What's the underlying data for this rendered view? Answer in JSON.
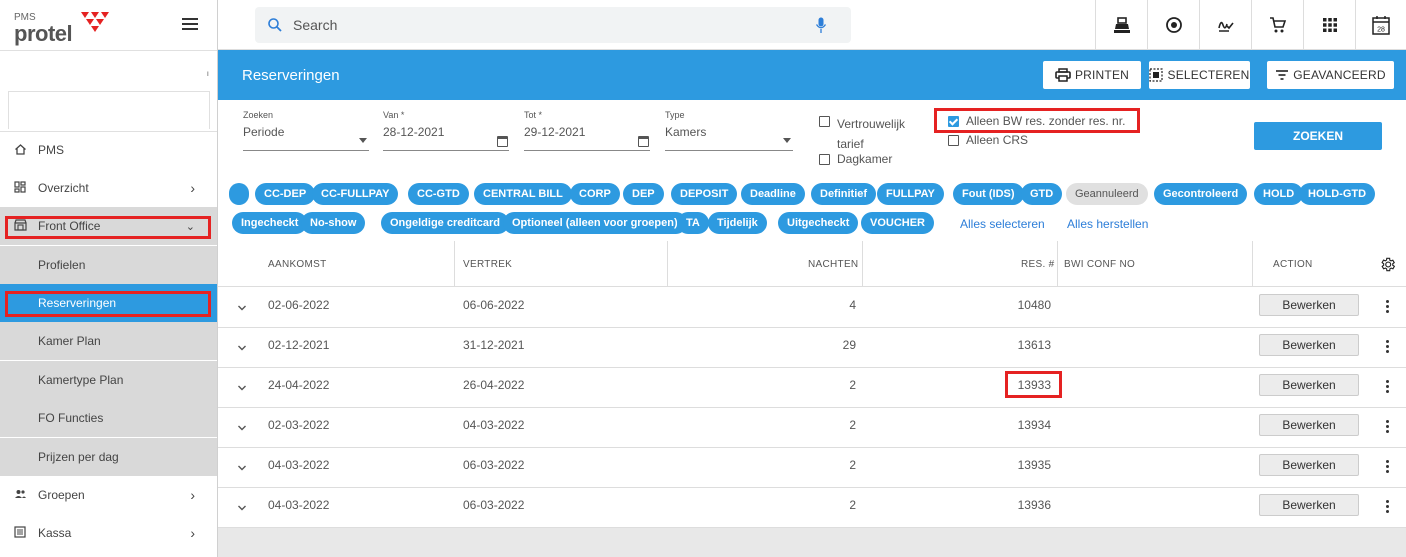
{
  "app": {
    "pms_label": "PMS",
    "brand": "protel"
  },
  "sidebar": {
    "items": [
      {
        "label": "PMS"
      },
      {
        "label": "Overzicht"
      },
      {
        "label": "Front Office"
      },
      {
        "label": "Profielen"
      },
      {
        "label": "Reserveringen"
      },
      {
        "label": "Kamer Plan"
      },
      {
        "label": "Kamertype Plan"
      },
      {
        "label": "FO Functies"
      },
      {
        "label": "Prijzen per dag"
      },
      {
        "label": "Groepen"
      },
      {
        "label": "Kassa"
      }
    ]
  },
  "topbar": {
    "search_placeholder": "Search",
    "calendar_day": "28"
  },
  "header": {
    "title": "Reserveringen",
    "print_label": "PRINTEN",
    "select_label": "SELECTEREN",
    "advanced_label": "GEAVANCEERD"
  },
  "filters": {
    "zoeken": {
      "label": "Zoeken",
      "value": "Periode"
    },
    "van": {
      "label": "Van *",
      "value": "28-12-2021"
    },
    "tot": {
      "label": "Tot *",
      "value": "29-12-2021"
    },
    "type": {
      "label": "Type",
      "value": "Kamers"
    },
    "confidential_line1": "Vertrouwelijk",
    "confidential_line2": "tarief",
    "dayroom": "Dagkamer",
    "bw_only": "Alleen BW res. zonder res. nr.",
    "crs_only": "Alleen CRS",
    "search_button": "ZOEKEN"
  },
  "tags": [
    "CC-DEP",
    "CC-FULLPAY",
    "CC-GTD",
    "CENTRAL BILL",
    "CORP",
    "DEP",
    "DEPOSIT",
    "Deadline",
    "Definitief",
    "FULLPAY",
    "Fout (IDS)",
    "GTD",
    "Geannuleerd",
    "Gecontroleerd",
    "HOLD",
    "HOLD-GTD",
    "Ingecheckt",
    "No-show",
    "Ongeldige creditcard",
    "Optioneel (alleen voor groepen)",
    "TA",
    "Tijdelijk",
    "Uitgecheckt",
    "VOUCHER"
  ],
  "tag_links": {
    "select_all": "Alles selecteren",
    "reset_all": "Alles herstellen"
  },
  "table": {
    "headers": {
      "arrival": "AANKOMST",
      "departure": "VERTREK",
      "nights": "NACHTEN",
      "res": "RES. #",
      "bwi": "BWI CONF NO",
      "action": "ACTION"
    },
    "edit_label": "Bewerken",
    "rows": [
      {
        "arrival": "02-06-2022",
        "departure": "06-06-2022",
        "nights": "4",
        "res": "10480",
        "bwi": ""
      },
      {
        "arrival": "02-12-2021",
        "departure": "31-12-2021",
        "nights": "29",
        "res": "13613",
        "bwi": ""
      },
      {
        "arrival": "24-04-2022",
        "departure": "26-04-2022",
        "nights": "2",
        "res": "13933",
        "bwi": ""
      },
      {
        "arrival": "02-03-2022",
        "departure": "04-03-2022",
        "nights": "2",
        "res": "13934",
        "bwi": ""
      },
      {
        "arrival": "04-03-2022",
        "departure": "06-03-2022",
        "nights": "2",
        "res": "13935",
        "bwi": ""
      },
      {
        "arrival": "04-03-2022",
        "departure": "06-03-2022",
        "nights": "2",
        "res": "13936",
        "bwi": ""
      }
    ]
  },
  "colors": {
    "accent": "#2d9ae0",
    "highlight": "#e52222"
  }
}
